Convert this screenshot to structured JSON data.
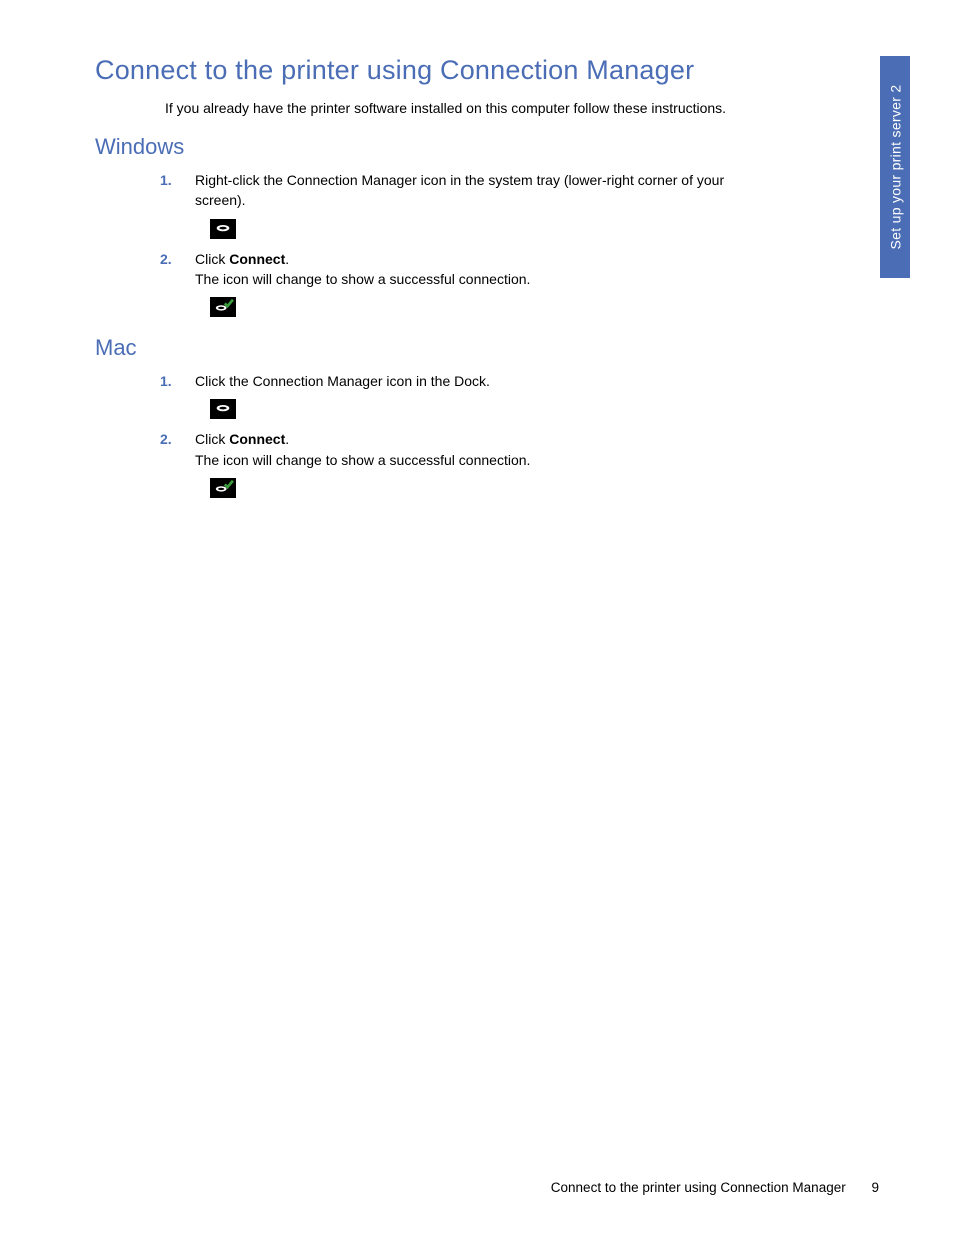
{
  "page_title": "Connect to the printer using Connection Manager",
  "intro_text": "If you already have the printer software installed on this computer follow these instructions.",
  "side_tab": "Set up your print server 2",
  "sections": {
    "windows": {
      "heading": "Windows",
      "steps": {
        "s1": {
          "num": "1.",
          "text": "Right-click the Connection Manager icon in the system tray (lower-right corner of your screen)."
        },
        "s2": {
          "num": "2.",
          "prefix": "Click ",
          "bold": "Connect",
          "suffix": ".",
          "line2": "The icon will change to show a successful connection."
        }
      }
    },
    "mac": {
      "heading": "Mac",
      "steps": {
        "s1": {
          "num": "1.",
          "text": "Click the Connection Manager icon in the Dock."
        },
        "s2": {
          "num": "2.",
          "prefix": "Click ",
          "bold": "Connect",
          "suffix": ".",
          "line2": "The icon will change to show a successful connection."
        }
      }
    }
  },
  "footer": {
    "text": "Connect to the printer using Connection Manager",
    "page_number": "9"
  }
}
